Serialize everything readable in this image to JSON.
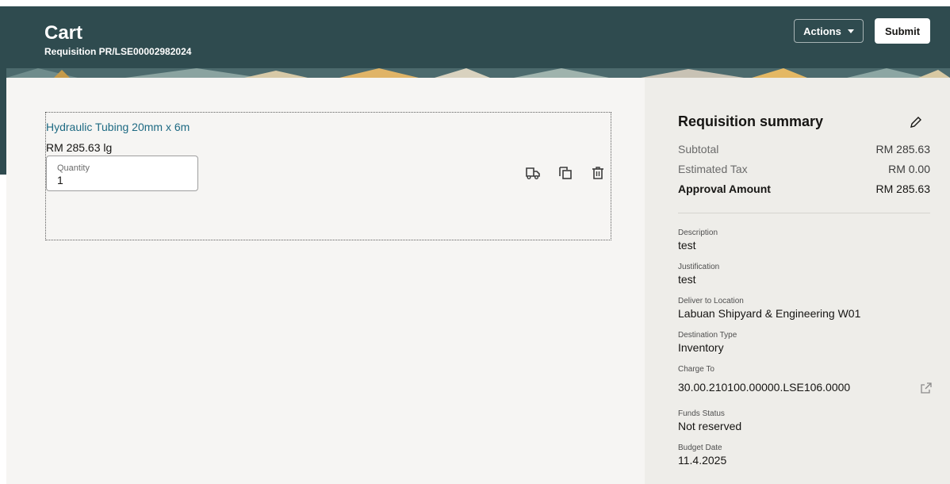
{
  "header": {
    "title": "Cart",
    "subtitle": "Requisition PR/LSE00002982024",
    "actions_label": "Actions",
    "submit_label": "Submit",
    "bg_color": "#2f4b4f"
  },
  "cart": {
    "item": {
      "name": "Hydraulic Tubing 20mm x 6m",
      "price": "RM 285.63 lg",
      "quantity_label": "Quantity",
      "quantity_value": "1"
    },
    "icons": [
      "deliver-icon",
      "duplicate-icon",
      "delete-icon"
    ]
  },
  "summary": {
    "title": "Requisition summary",
    "subtotal_label": "Subtotal",
    "subtotal_value": "RM 285.63",
    "tax_label": "Estimated Tax",
    "tax_value": "RM 0.00",
    "approval_label": "Approval Amount",
    "approval_value": "RM 285.63",
    "fields": {
      "description": {
        "label": "Description",
        "value": "test"
      },
      "justification": {
        "label": "Justification",
        "value": "test"
      },
      "deliver_to": {
        "label": "Deliver to Location",
        "value": "Labuan Shipyard & Engineering W01"
      },
      "destination_type": {
        "label": "Destination Type",
        "value": "Inventory"
      },
      "charge_to": {
        "label": "Charge To",
        "value": "30.00.210100.00000.LSE106.0000"
      },
      "funds_status": {
        "label": "Funds Status",
        "value": "Not reserved"
      },
      "budget_date": {
        "label": "Budget Date",
        "value": "11.4.2025"
      }
    }
  }
}
